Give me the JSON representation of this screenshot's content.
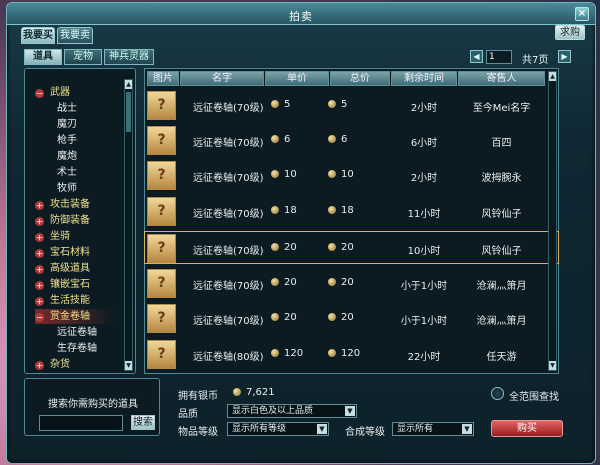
{
  "window": {
    "title": "拍卖",
    "close_glyph": "×"
  },
  "tabs": [
    {
      "label": "我要买",
      "active": true
    },
    {
      "label": "我要卖",
      "active": false
    }
  ],
  "buy_button": "求购",
  "subtabs": [
    {
      "label": "道具",
      "active": true
    },
    {
      "label": "宠物",
      "active": false
    },
    {
      "label": "神兵灵器",
      "active": false
    }
  ],
  "pager": {
    "prev": "◀",
    "current": "1",
    "total": "共7页",
    "next": "▶"
  },
  "categories": [
    {
      "label": "武器",
      "level": "main",
      "toggle": "−"
    },
    {
      "label": "战士",
      "level": "sub"
    },
    {
      "label": "魔刃",
      "level": "sub"
    },
    {
      "label": "枪手",
      "level": "sub"
    },
    {
      "label": "魔炮",
      "level": "sub"
    },
    {
      "label": "术士",
      "level": "sub"
    },
    {
      "label": "牧师",
      "level": "sub"
    },
    {
      "label": "攻击装备",
      "level": "main",
      "toggle": "+"
    },
    {
      "label": "防御装备",
      "level": "main",
      "toggle": "+"
    },
    {
      "label": "坐骑",
      "level": "main",
      "toggle": "+"
    },
    {
      "label": "宝石材料",
      "level": "main",
      "toggle": "+"
    },
    {
      "label": "高级道具",
      "level": "main",
      "toggle": "+"
    },
    {
      "label": "镶嵌宝石",
      "level": "main",
      "toggle": "+"
    },
    {
      "label": "生活技能",
      "level": "main",
      "toggle": "+"
    },
    {
      "label": "赏金卷轴",
      "level": "main",
      "toggle": "−",
      "selected": true
    },
    {
      "label": "远征卷轴",
      "level": "sub"
    },
    {
      "label": "生存卷轴",
      "level": "sub"
    },
    {
      "label": "杂货",
      "level": "main",
      "toggle": "+"
    }
  ],
  "table": {
    "headers": [
      "图片",
      "名字",
      "单价",
      "总价",
      "剩余时间",
      "寄售人"
    ],
    "rows": [
      {
        "name": "远征卷轴(70级)",
        "unit": "5",
        "total": "5",
        "time": "2小时",
        "seller": "至今Mei名字"
      },
      {
        "name": "远征卷轴(70级)",
        "unit": "6",
        "total": "6",
        "time": "6小时",
        "seller": "百四"
      },
      {
        "name": "远征卷轴(70级)",
        "unit": "10",
        "total": "10",
        "time": "2小时",
        "seller": "波拇腕永"
      },
      {
        "name": "远征卷轴(70级)",
        "unit": "18",
        "total": "18",
        "time": "11小时",
        "seller": "风铃仙子"
      },
      {
        "name": "远征卷轴(70级)",
        "unit": "20",
        "total": "20",
        "time": "10小时",
        "seller": "风铃仙子",
        "selected": true
      },
      {
        "name": "远征卷轴(70级)",
        "unit": "20",
        "total": "20",
        "time": "小于1小时",
        "seller": "沧澜灬箫月"
      },
      {
        "name": "远征卷轴(70级)",
        "unit": "20",
        "total": "20",
        "time": "小于1小时",
        "seller": "沧澜灬箫月"
      },
      {
        "name": "远征卷轴(80级)",
        "unit": "120",
        "total": "120",
        "time": "22小时",
        "seller": "任天游"
      }
    ]
  },
  "search": {
    "title": "搜索你需购买的道具",
    "button": "搜索",
    "placeholder": ""
  },
  "silver": {
    "label": "拥有银币",
    "amount": "7,621"
  },
  "fullrange": {
    "label": "全范围查找"
  },
  "quality": {
    "label": "品质",
    "value": "显示白色及以上品质"
  },
  "item_level": {
    "label": "物品等级",
    "value": "显示所有等级"
  },
  "synth_level": {
    "label": "合成等级",
    "value": "显示所有"
  },
  "purchase_button": "购买",
  "icons": {
    "item_thumb": "?",
    "scroll_up": "▲",
    "scroll_down": "▼",
    "dropdown_arrow": "▼"
  }
}
